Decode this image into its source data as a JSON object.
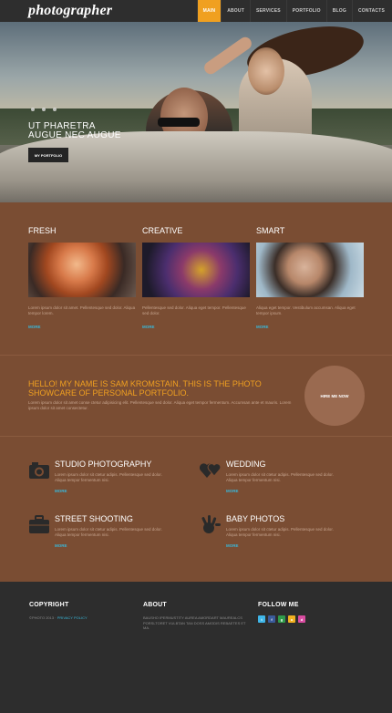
{
  "header": {
    "logo": "photographer",
    "nav": [
      {
        "label": "MAIN",
        "active": true
      },
      {
        "label": "ABOUT",
        "active": false
      },
      {
        "label": "SERVICES",
        "active": false
      },
      {
        "label": "PORTFOLIO",
        "active": false
      },
      {
        "label": "BLOG",
        "active": false
      },
      {
        "label": "CONTACTS",
        "active": false
      }
    ]
  },
  "hero": {
    "title_line1": "UT PHARETRA",
    "title_line2": "AUGUE NEC AUGUE",
    "button_label": "MY PORTFOLIO"
  },
  "features": [
    {
      "title": "FRESH",
      "text": "Lorem ipsum dolor sit amet. Pellentesque sed dolor. Aliqua tempor lorem.",
      "more": "MORE"
    },
    {
      "title": "CREATIVE",
      "text": "Pellentesque sed dolor. Aliqua eget tempor. Pellentesque sed dolor.",
      "more": "MORE"
    },
    {
      "title": "SMART",
      "text": "Aliqua eget tempor. Vestibulum accumsan. Aliqua eget tempor ipsum.",
      "more": "MORE"
    }
  ],
  "hello": {
    "title": "HELLO! MY NAME IS SAM KROMSTAIN. THIS IS THE PHOTO SHOWCARE OF PERSONAL PORTFOLIO.",
    "text": "Lorem ipsum dolor sit amet conse ctetur adipisicing elit. Pellentesque sed dolor. Aliqua eget tempor fermentum. Accumsan ante et mauris. Lorem ipsum dolor sit amet consectetur.",
    "button_label": "HIRE ME NOW"
  },
  "services": [
    {
      "title": "STUDIO PHOTOGRAPHY",
      "text": "Lorem ipsum dolor sit ctetur adipis. Pellentesque sed dolor. Aliqua tempor fermentum nisi.",
      "more": "MORE",
      "icon": "camera-icon"
    },
    {
      "title": "WEDDING",
      "text": "Lorem ipsum dolor sit ctetur adipis. Pellentesque sed dolor. Aliqua tempor fermentum nisi.",
      "more": "MORE",
      "icon": "hearts-icon"
    },
    {
      "title": "STREET SHOOTING",
      "text": "Lorem ipsum dolor sit ctetur adipis. Pellentesque sed dolor. Aliqua tempor fermentum nisi.",
      "more": "MORE",
      "icon": "suitcase-icon"
    },
    {
      "title": "BABY PHOTOS",
      "text": "Lorem ipsum dolor sit ctetur adipis. Pellentesque sed dolor. Aliqua tempor fermentum nisi.",
      "more": "MORE",
      "icon": "baby-hand-icon"
    }
  ],
  "footer": {
    "copyright_title": "COPYRIGHT",
    "copyright_text": "©PHOTO 2013 ·",
    "privacy_link": "PRIVACY POLICY",
    "about_title": "ABOUT",
    "about_text": "BAUSHO IPERMUSTITY AUREA AMORDART MAUREALCS PORSLTORET VULBTAN TAN DOSS AMODIS REBAETES ET MA.",
    "follow_title": "FOLLOW ME",
    "socials": [
      {
        "label": "t",
        "color": "#3fb6e8"
      },
      {
        "label": "f",
        "color": "#3a5b9b"
      },
      {
        "label": "g",
        "color": "#2f9b4a"
      },
      {
        "label": "a",
        "color": "#f0b020"
      },
      {
        "label": "d",
        "color": "#d84ca0"
      }
    ]
  },
  "colors": {
    "accent": "#f0a020",
    "link": "#39b7d9",
    "brown": "#7a4d33",
    "dark": "#2d2d2d"
  }
}
